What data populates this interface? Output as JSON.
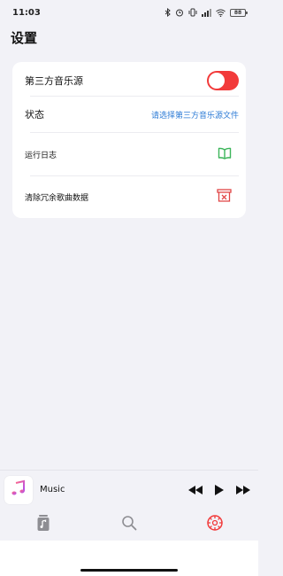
{
  "status_bar": {
    "time": "11:03",
    "battery_level": "88"
  },
  "page": {
    "title": "设置"
  },
  "settings": {
    "third_party_source": {
      "label": "第三方音乐源",
      "enabled": true
    },
    "status": {
      "label": "状态",
      "value": "请选择第三方音乐源文件"
    },
    "run_log": {
      "label": "运行日志",
      "icon": "book-icon"
    },
    "clear_data": {
      "label": "清除冗余歌曲数据",
      "icon": "trash-icon"
    }
  },
  "mini_player": {
    "track_title": "Music"
  },
  "tabs": [
    {
      "name": "library",
      "icon": "music-library-icon",
      "active": false
    },
    {
      "name": "search",
      "icon": "search-icon",
      "active": false
    },
    {
      "name": "settings",
      "icon": "gear-icon",
      "active": true
    }
  ],
  "colors": {
    "accent": "#f23a3a",
    "link": "#2d7bd6",
    "log_icon": "#3cb55a",
    "clear_icon": "#e04545",
    "background": "#f2f2f7"
  }
}
